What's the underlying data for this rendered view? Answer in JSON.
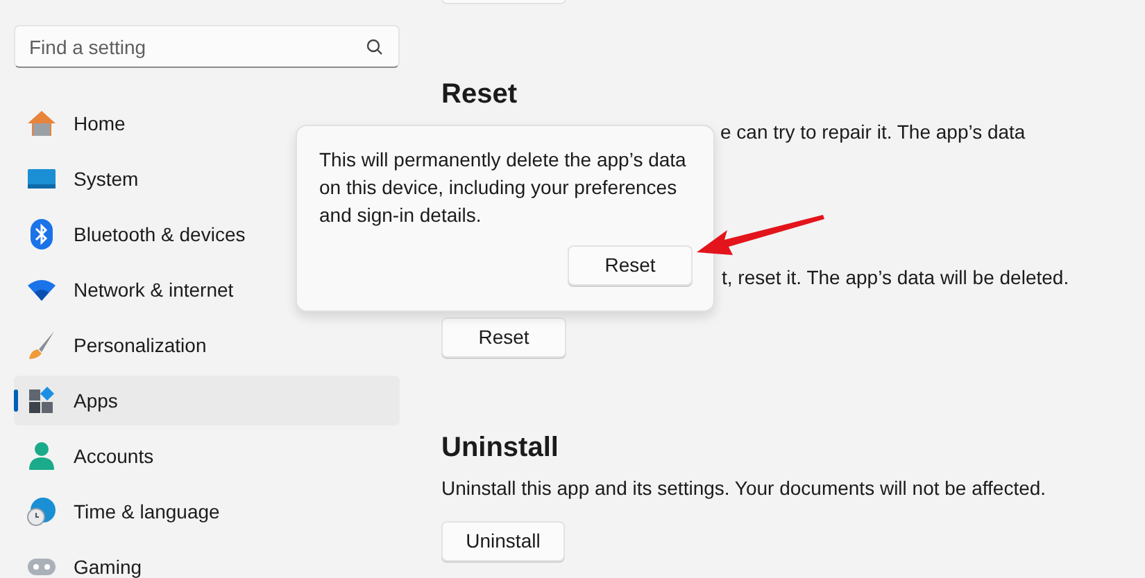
{
  "search": {
    "placeholder": "Find a setting"
  },
  "sidebar": {
    "items": [
      {
        "label": "Home",
        "kind": "home",
        "selected": false
      },
      {
        "label": "System",
        "kind": "system",
        "selected": false
      },
      {
        "label": "Bluetooth & devices",
        "kind": "bluetooth",
        "selected": false
      },
      {
        "label": "Network & internet",
        "kind": "network",
        "selected": false
      },
      {
        "label": "Personalization",
        "kind": "brush",
        "selected": false
      },
      {
        "label": "Apps",
        "kind": "apps",
        "selected": true
      },
      {
        "label": "Accounts",
        "kind": "accounts",
        "selected": false
      },
      {
        "label": "Time & language",
        "kind": "time",
        "selected": false
      },
      {
        "label": "Gaming",
        "kind": "gaming",
        "selected": false
      }
    ]
  },
  "reset_section": {
    "title": "Reset",
    "description_line_1": "e can try to repair it. The app’s data",
    "description_line_2": "t, reset it. The app’s data will be deleted.",
    "button": "Reset"
  },
  "uninstall_section": {
    "title": "Uninstall",
    "description": "Uninstall this app and its settings. Your documents will not be affected.",
    "button": "Uninstall"
  },
  "flyout": {
    "message": "This will permanently delete the app’s data on this device, including your preferences and sign-in details.",
    "button": "Reset"
  }
}
